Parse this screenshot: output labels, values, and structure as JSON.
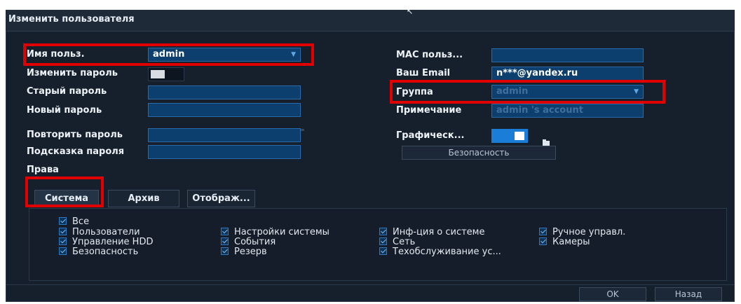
{
  "dialog": {
    "title": "Изменить пользователя"
  },
  "left": {
    "username_label": "Имя польз.",
    "username_value": "admin",
    "change_password_label": "Изменить пароль",
    "old_password_label": "Старый пароль",
    "new_password_label": "Новый пароль",
    "repeat_password_label": "Повторить пароль",
    "password_hint_label": "Подсказка пароля",
    "rights_label": "Права"
  },
  "right": {
    "mac_label": "МАС польз...",
    "email_label": "Ваш Email",
    "email_value": "n***@yandex.ru",
    "group_label": "Группа",
    "group_value": "admin",
    "note_label": "Примечание",
    "note_value": "admin 's account",
    "graphic_label": "Графическ...",
    "security_button": "Безопасность"
  },
  "tabs": [
    {
      "label": "Система",
      "active": true
    },
    {
      "label": "Архив",
      "active": false
    },
    {
      "label": "Отображ...",
      "active": false
    }
  ],
  "permissions": {
    "all": "Все",
    "col1": [
      "Пользователи",
      "Управление HDD",
      "Безопасность"
    ],
    "col2": [
      "Настройки системы",
      "События",
      "Резерв"
    ],
    "col3": [
      "Инф-ция о системе",
      "Сеть",
      "Техобслуживание ус..."
    ],
    "col4": [
      "Ручное управл.",
      "Камеры"
    ]
  },
  "footer": {
    "ok": "OK",
    "back": "Назад"
  },
  "colors": {
    "dialog_bg": "#16202d",
    "field_bg": "#0d3f6e",
    "accent": "#1a7ed8",
    "highlight": "#e00000"
  },
  "icons": [
    "chevron-down-icon",
    "folder-icon",
    "checkbox-checked-icon",
    "mouse-cursor-icon"
  ]
}
